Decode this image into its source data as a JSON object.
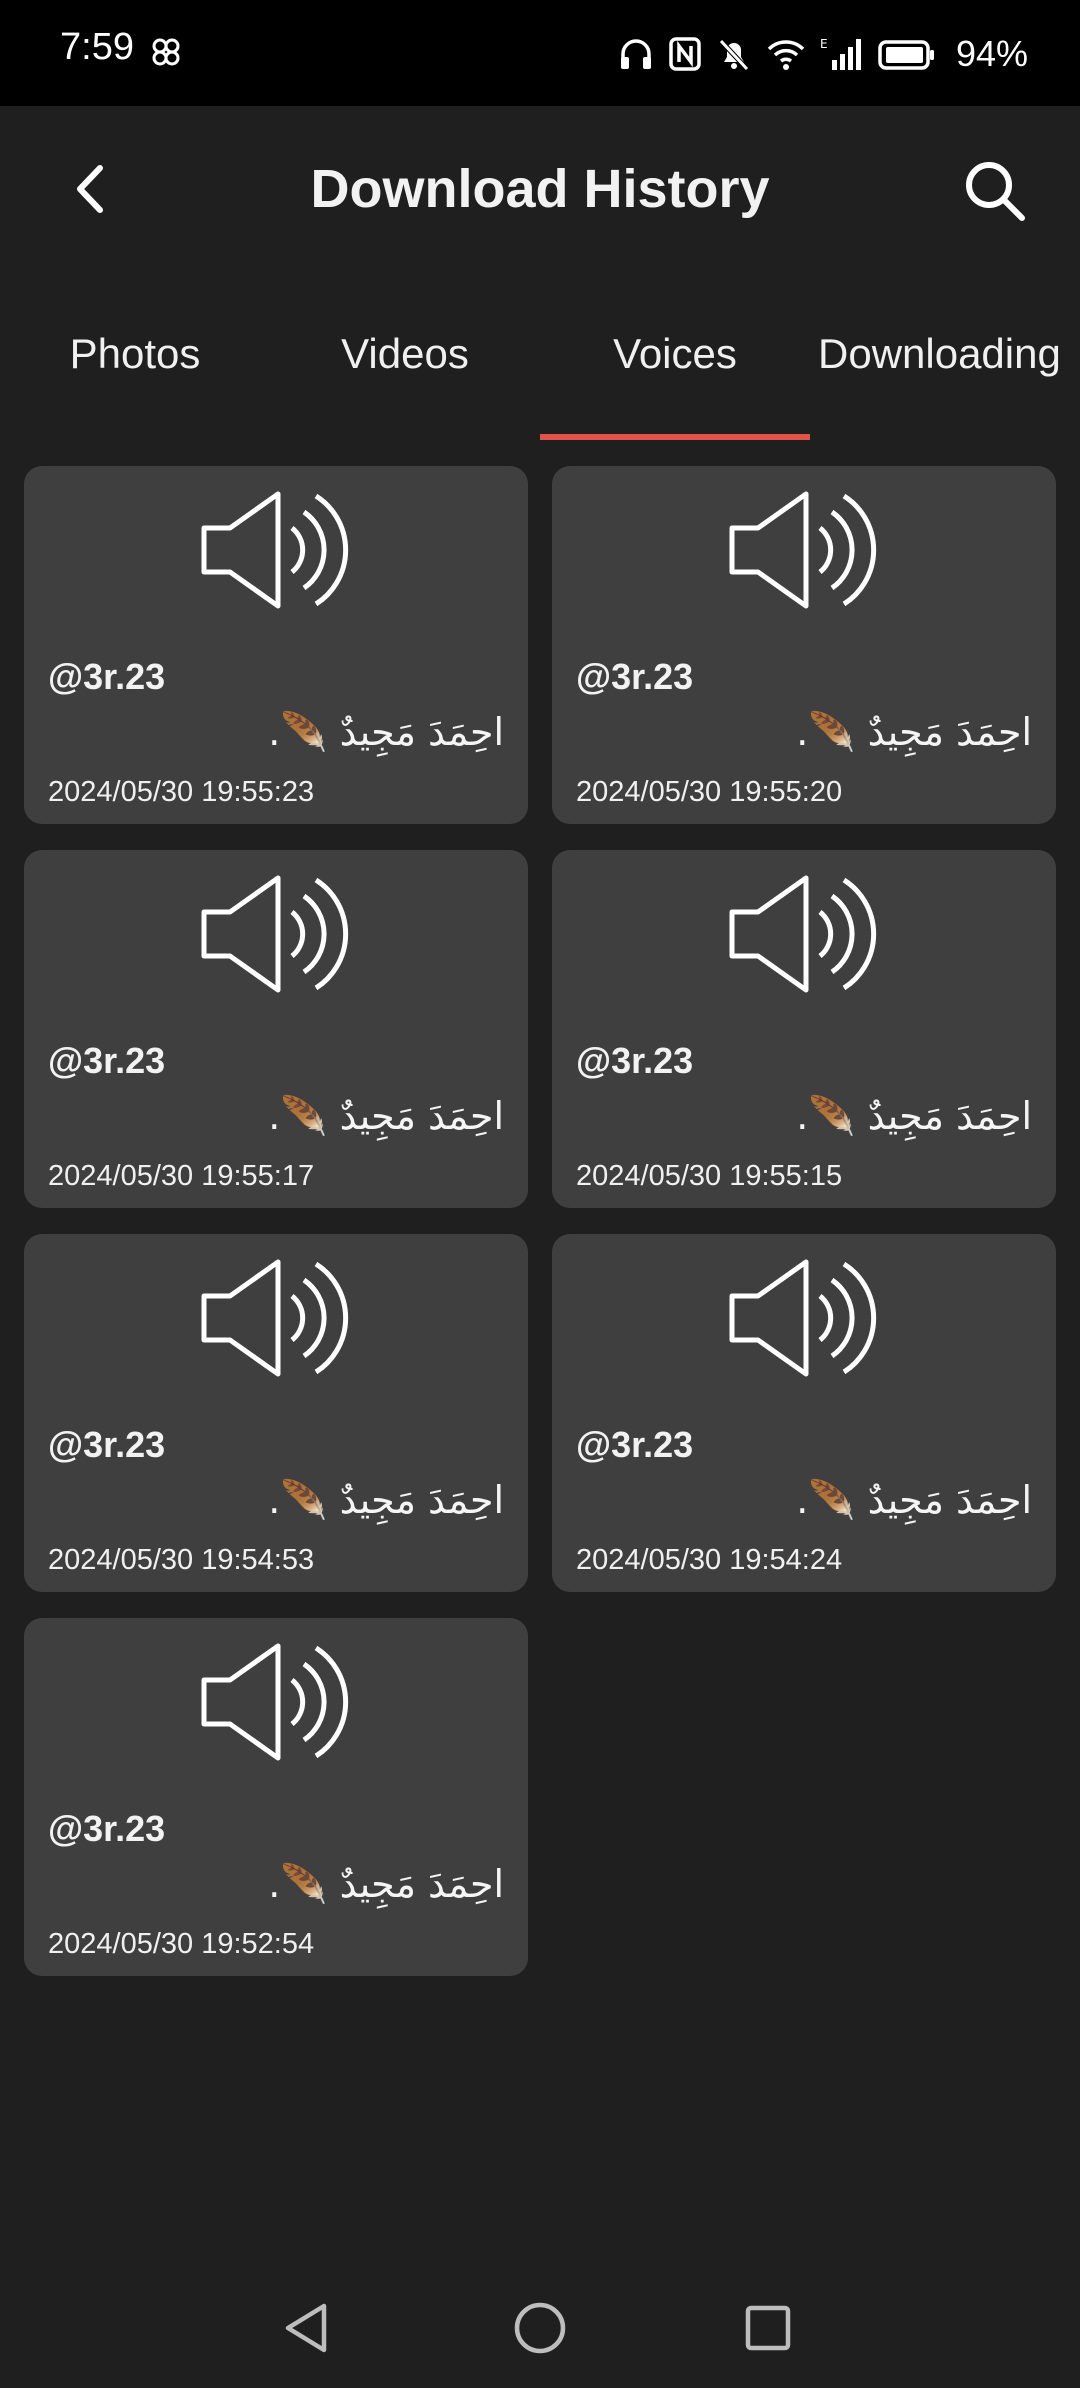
{
  "status_bar": {
    "time": "7:59",
    "battery": "94%"
  },
  "header": {
    "title": "Download History"
  },
  "tabs": [
    {
      "label": "Photos",
      "active": false
    },
    {
      "label": "Videos",
      "active": false
    },
    {
      "label": "Voices",
      "active": true
    },
    {
      "label": "Downloading",
      "active": false
    }
  ],
  "accent_color": "#e0524a",
  "items": [
    {
      "handle": "@3r.23",
      "name": "احِمَدَ مَجِيدٌ 🪶.",
      "date": "2024/05/30 19:55:23",
      "icon": "speaker-icon"
    },
    {
      "handle": "@3r.23",
      "name": "احِمَدَ مَجِيدٌ 🪶.",
      "date": "2024/05/30 19:55:20",
      "icon": "speaker-icon"
    },
    {
      "handle": "@3r.23",
      "name": "احِمَدَ مَجِيدٌ 🪶.",
      "date": "2024/05/30 19:55:17",
      "icon": "speaker-icon"
    },
    {
      "handle": "@3r.23",
      "name": "احِمَدَ مَجِيدٌ 🪶.",
      "date": "2024/05/30 19:55:15",
      "icon": "speaker-icon"
    },
    {
      "handle": "@3r.23",
      "name": "احِمَدَ مَجِيدٌ 🪶.",
      "date": "2024/05/30 19:54:53",
      "icon": "speaker-icon"
    },
    {
      "handle": "@3r.23",
      "name": "احِمَدَ مَجِيدٌ 🪶.",
      "date": "2024/05/30 19:54:24",
      "icon": "speaker-icon"
    },
    {
      "handle": "@3r.23",
      "name": "احِمَدَ مَجِيدٌ 🪶.",
      "date": "2024/05/30 19:52:54",
      "icon": "speaker-icon"
    }
  ]
}
